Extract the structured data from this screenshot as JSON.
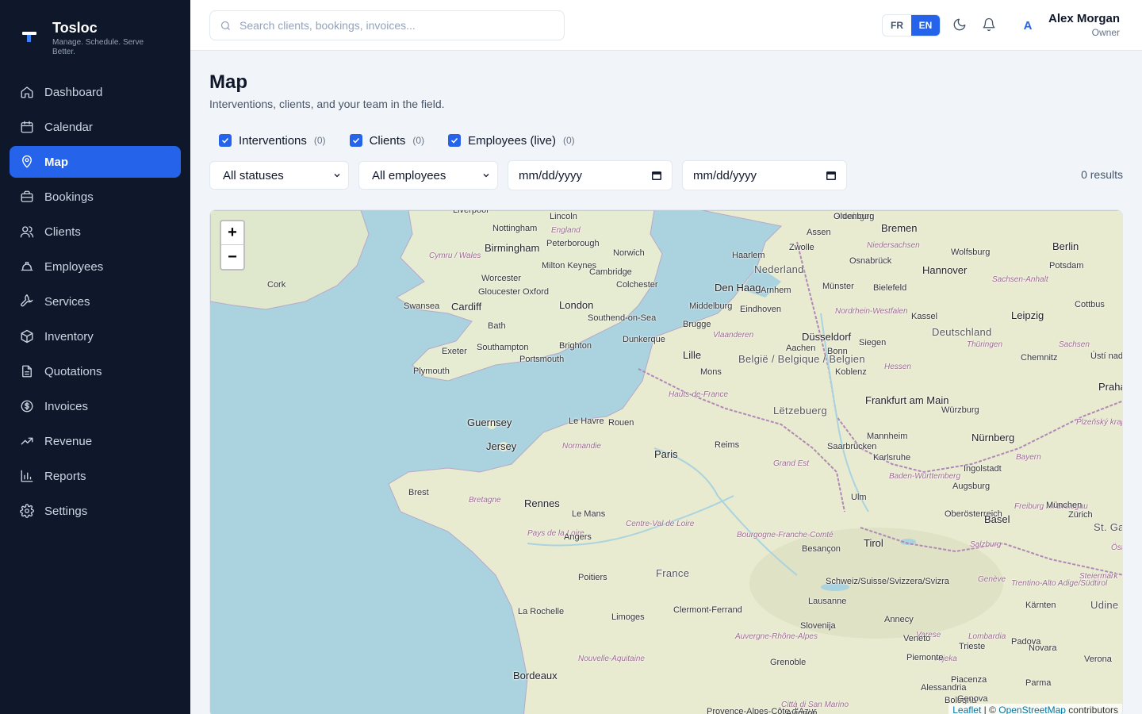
{
  "brand": {
    "name": "Tosloc",
    "tagline": "Manage. Schedule. Serve Better."
  },
  "nav": [
    {
      "label": "Dashboard",
      "icon": "home-icon"
    },
    {
      "label": "Calendar",
      "icon": "calendar-icon"
    },
    {
      "label": "Map",
      "icon": "map-pin-icon",
      "active": true
    },
    {
      "label": "Bookings",
      "icon": "briefcase-icon"
    },
    {
      "label": "Clients",
      "icon": "users-icon"
    },
    {
      "label": "Employees",
      "icon": "hard-hat-icon"
    },
    {
      "label": "Services",
      "icon": "wrench-icon"
    },
    {
      "label": "Inventory",
      "icon": "package-icon"
    },
    {
      "label": "Quotations",
      "icon": "document-icon"
    },
    {
      "label": "Invoices",
      "icon": "dollar-icon"
    },
    {
      "label": "Revenue",
      "icon": "trending-up-icon"
    },
    {
      "label": "Reports",
      "icon": "bar-chart-icon"
    },
    {
      "label": "Settings",
      "icon": "gear-icon"
    }
  ],
  "topbar": {
    "search_placeholder": "Search clients, bookings, invoices...",
    "lang_fr": "FR",
    "lang_en": "EN",
    "active_lang": "EN",
    "avatar_initial": "A",
    "user_name": "Alex Morgan",
    "user_role": "Owner"
  },
  "page": {
    "title": "Map",
    "subtitle": "Interventions, clients, and your team in the field.",
    "layers": [
      {
        "label": "Interventions",
        "count": "(0)",
        "checked": true
      },
      {
        "label": "Clients",
        "count": "(0)",
        "checked": true
      },
      {
        "label": "Employees (live)",
        "count": "(0)",
        "checked": true
      }
    ],
    "filters": {
      "status": "All statuses",
      "employee": "All employees",
      "date_from": "mm/dd/yyyy",
      "date_to": "mm/dd/yyyy"
    },
    "results": "0 results"
  },
  "map": {
    "zoom_in": "+",
    "zoom_out": "−",
    "attribution": {
      "leaflet": "Leaflet",
      "separator": " | © ",
      "osm": "OpenStreetMap",
      "suffix": " contributors"
    },
    "labels": [
      "Liverpool",
      "Lincoln",
      "Nottingham",
      "England",
      "Birmingham",
      "Peterborough",
      "Norwich",
      "Cymru / Wales",
      "Milton Keynes",
      "Cambridge",
      "Colchester",
      "Worcester",
      "Gloucester",
      "Oxford",
      "Cork",
      "Swansea",
      "Cardiff",
      "London",
      "Southend-on-Sea",
      "Bath",
      "Exeter",
      "Southampton",
      "Brighton",
      "Dunkerque",
      "Portsmouth",
      "Plymouth",
      "Guernsey",
      "Jersey",
      "Le Havre",
      "Rouen",
      "Normandie",
      "Paris",
      "Reims",
      "Brest",
      "Bretagne",
      "Rennes",
      "Le Mans",
      "Pays de la Loire",
      "Angers",
      "Centre-Val de Loire",
      "France",
      "Poitiers",
      "La Rochelle",
      "Limoges",
      "Clermont-Ferrand",
      "Nouvelle-Aquitaine",
      "Bordeaux",
      "Auvergne-Rhône-Alpes",
      "Grenoble",
      "Bourgogne-Franche-Comté",
      "Besançon",
      "Grand Est",
      "Lille",
      "Mons",
      "Brugge",
      "Vlaanderen",
      "België / Belgique / Belgien",
      "Hauts-de-France",
      "Lëtzebuerg",
      "Groningen",
      "Oldenburg",
      "Bremen",
      "Assen",
      "Niedersachsen",
      "Haarlem",
      "Zwolle",
      "Nederland",
      "Osnabrück",
      "Hannover",
      "Wolfsburg",
      "Berlin",
      "Potsdam",
      "Den Haag",
      "Arnhem",
      "Münster",
      "Bielefeld",
      "Sachsen-Anhalt",
      "Middelburg",
      "Eindhoven",
      "Nordrhein-Westfalen",
      "Kassel",
      "Leipzig",
      "Cottbus",
      "Deutschland",
      "Düsseldorf",
      "Aachen",
      "Bonn",
      "Siegen",
      "Thüringen",
      "Sachsen",
      "Chemnitz",
      "Ústí nad Labem",
      "Koblenz",
      "Hessen",
      "Frankfurt am Main",
      "Praha",
      "Würzburg",
      "Plzeňský kraj",
      "Mannheim",
      "Nürnberg",
      "Saarbrücken",
      "Karlsruhe",
      "Ingolstadt",
      "Bayern",
      "Baden-Württemberg",
      "Augsburg",
      "Freiburg im Breisgau",
      "Ulm",
      "Oberösterreich",
      "München",
      "Basel",
      "Zürich",
      "St. Gallen",
      "Salzburg",
      "Österreich",
      "Tirol",
      "Steiermark",
      "Schweiz/Suisse/Svizzera/Svizra",
      "Lausanne",
      "Genève",
      "Trentino-Alto Adige/Südtirol",
      "Kärnten",
      "Udine",
      "Slovenija",
      "Annecy",
      "Varese",
      "Lombardia",
      "Veneto",
      "Trieste",
      "Novara",
      "Verona",
      "Padova",
      "Rijeka",
      "Piemonte",
      "Piacenza",
      "Alessandria",
      "Parma",
      "Bologna",
      "Genova",
      "Città di San Marino",
      "Provence-Alpes-Côte d'Azur",
      "Avignon"
    ]
  }
}
